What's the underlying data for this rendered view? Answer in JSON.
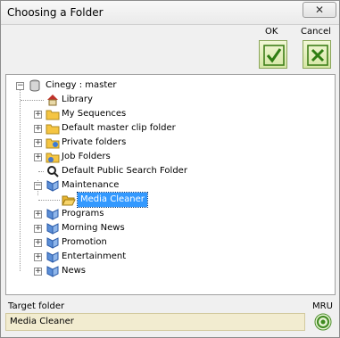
{
  "window": {
    "title": "Choosing a Folder",
    "close_glyph": "✕"
  },
  "actions": {
    "ok_label": "OK",
    "cancel_label": "Cancel"
  },
  "tree": {
    "root": "Cinegy : master",
    "items": [
      {
        "label": "Library",
        "icon": "house-icon"
      },
      {
        "label": "My Sequences",
        "icon": "folder-icon"
      },
      {
        "label": "Default master clip folder",
        "icon": "folder-icon"
      },
      {
        "label": "Private folders",
        "icon": "private-folder-icon"
      },
      {
        "label": "Job Folders",
        "icon": "job-folder-icon"
      },
      {
        "label": "Default Public Search Folder",
        "icon": "search-folder-icon"
      },
      {
        "label": "Maintenance",
        "icon": "roll-icon"
      },
      {
        "label": "Media Cleaner",
        "icon": "folder-open-icon",
        "selected": true
      },
      {
        "label": "Programs",
        "icon": "roll-icon"
      },
      {
        "label": "Morning News",
        "icon": "roll-icon"
      },
      {
        "label": "Promotion",
        "icon": "roll-icon"
      },
      {
        "label": "Entertainment",
        "icon": "roll-icon"
      },
      {
        "label": "News",
        "icon": "roll-icon"
      }
    ]
  },
  "footer": {
    "target_label": "Target folder",
    "target_value": "Media Cleaner",
    "mru_label": "MRU"
  }
}
